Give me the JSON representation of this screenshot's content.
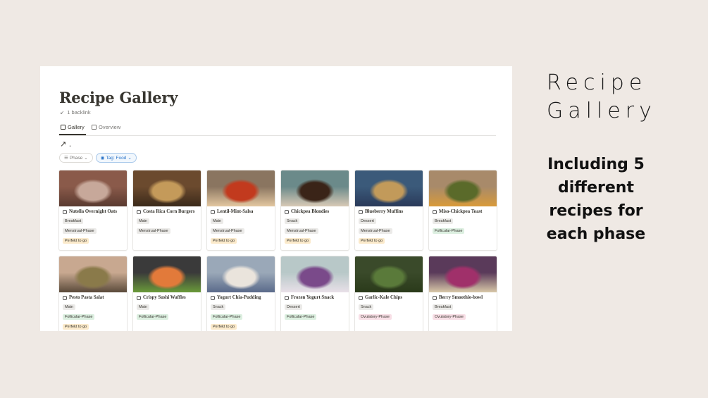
{
  "page": {
    "title": "Recipe Gallery",
    "backlink": "1 backlink",
    "tabs": [
      {
        "label": "Gallery",
        "active": true
      },
      {
        "label": "Overview",
        "active": false
      }
    ],
    "link_marker": "↗ .",
    "filters": [
      {
        "label": "Phase",
        "icon": "list-icon"
      },
      {
        "label": "Tag: Food",
        "icon": "tag-icon"
      }
    ]
  },
  "tag_colors": {
    "Breakfast": "#ebeae8",
    "Main": "#ebeae8",
    "Snack": "#ebeae8",
    "Dessert": "#ebeae8",
    "Menstrual-Phase": "#ebeae8",
    "Follicular-Phase": "#dcefe0",
    "Ovulatory-Phase": "#f8dfe6",
    "Perfekt to go": "#fbeacb"
  },
  "cards": [
    {
      "title": "Nutella Overnight Oats",
      "icon": "bowl-icon",
      "tags": [
        "Breakfast",
        "Menstrual-Phase",
        "Perfekt to go"
      ],
      "photo": [
        "#8a5a4a",
        "#c7a89a",
        "#5a3a30"
      ]
    },
    {
      "title": "Costa Rica Corn Burgers",
      "icon": "burger-icon",
      "tags": [
        "Main",
        "Menstrual-Phase"
      ],
      "photo": [
        "#6b4a2e",
        "#c49a5a",
        "#3b2a1a"
      ]
    },
    {
      "title": "Lentil-Mint-Salsa",
      "icon": "spoon-icon",
      "tags": [
        "Main",
        "Menstrual-Phase",
        "Perfekt to go"
      ],
      "photo": [
        "#8a7560",
        "#c23a1e",
        "#e3c7a0"
      ]
    },
    {
      "title": "Chickpea Blondies",
      "icon": "cake-icon",
      "tags": [
        "Snack",
        "Menstrual-Phase",
        "Perfekt to go"
      ],
      "photo": [
        "#6b8a8a",
        "#3a2418",
        "#d8c9b5"
      ]
    },
    {
      "title": "Blueberry Muffins",
      "icon": "muffin-icon",
      "tags": [
        "Dessert",
        "Menstrual-Phase",
        "Perfekt to go"
      ],
      "photo": [
        "#3b5a7a",
        "#c29a5a",
        "#2a3a5a"
      ]
    },
    {
      "title": "Miso-Chickpea Toast",
      "icon": "toast-icon",
      "tags": [
        "Breakfast",
        "Follicular-Phase"
      ],
      "photo": [
        "#a88a6a",
        "#5a6a2a",
        "#d89a3a"
      ]
    },
    {
      "title": "Pesto Pasta Salat",
      "icon": "pasta-icon",
      "tags": [
        "Main",
        "Follicular-Phase",
        "Perfekt to go"
      ],
      "photo": [
        "#c8a890",
        "#8a7a4a",
        "#5a4a3a"
      ]
    },
    {
      "title": "Crispy Sushi Waffles",
      "icon": "chopsticks-icon",
      "tags": [
        "Main",
        "Follicular-Phase"
      ],
      "photo": [
        "#3a3a3a",
        "#e27a3a",
        "#6a9a3a"
      ]
    },
    {
      "title": "Yogurt Chia-Pudding",
      "icon": "bowl-icon",
      "tags": [
        "Snack",
        "Follicular-Phase",
        "Perfekt to go"
      ],
      "photo": [
        "#9aa8b8",
        "#eae4dc",
        "#5a6a8a"
      ]
    },
    {
      "title": "Frozen Yogurt Snack",
      "icon": "cup-icon",
      "tags": [
        "Dessert",
        "Follicular-Phase"
      ],
      "photo": [
        "#b8c8c8",
        "#7a4a8a",
        "#e8e0e8"
      ]
    },
    {
      "title": "Garlic-Kale Chips",
      "icon": "leaf-icon",
      "tags": [
        "Snack",
        "Ovulatory-Phase"
      ],
      "photo": [
        "#3a4a2a",
        "#5a7a3a",
        "#2a3a1a"
      ]
    },
    {
      "title": "Berry Smoothie-bowl",
      "icon": "blender-icon",
      "tags": [
        "Breakfast",
        "Ovulatory-Phase"
      ],
      "photo": [
        "#5a3a5a",
        "#a0306a",
        "#d8c8a8"
      ]
    }
  ],
  "side": {
    "heading_line1": "Recipe",
    "heading_line2": "Gallery",
    "sub": [
      "Including 5",
      "different",
      "recipes for",
      "each phase"
    ]
  },
  "colors": {
    "page_bg": "#efe9e4",
    "text": "#37352f",
    "muted": "#787774"
  }
}
